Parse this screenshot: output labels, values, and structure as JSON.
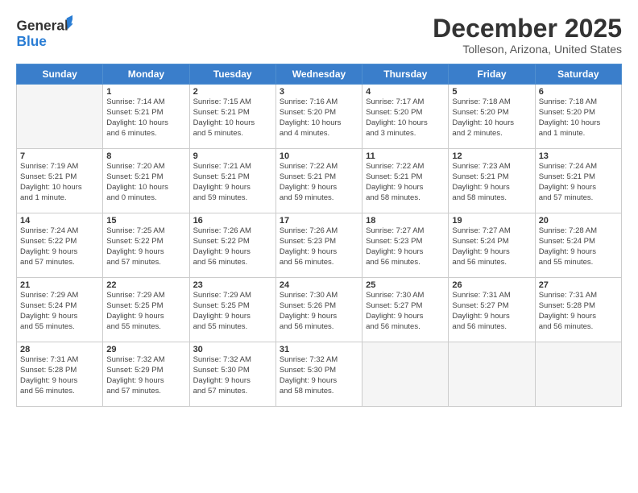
{
  "header": {
    "logo_line1": "General",
    "logo_line2": "Blue",
    "title": "December 2025",
    "subtitle": "Tolleson, Arizona, United States"
  },
  "days_of_week": [
    "Sunday",
    "Monday",
    "Tuesday",
    "Wednesday",
    "Thursday",
    "Friday",
    "Saturday"
  ],
  "weeks": [
    [
      {
        "day": "",
        "detail": ""
      },
      {
        "day": "1",
        "detail": "Sunrise: 7:14 AM\nSunset: 5:21 PM\nDaylight: 10 hours\nand 6 minutes."
      },
      {
        "day": "2",
        "detail": "Sunrise: 7:15 AM\nSunset: 5:21 PM\nDaylight: 10 hours\nand 5 minutes."
      },
      {
        "day": "3",
        "detail": "Sunrise: 7:16 AM\nSunset: 5:20 PM\nDaylight: 10 hours\nand 4 minutes."
      },
      {
        "day": "4",
        "detail": "Sunrise: 7:17 AM\nSunset: 5:20 PM\nDaylight: 10 hours\nand 3 minutes."
      },
      {
        "day": "5",
        "detail": "Sunrise: 7:18 AM\nSunset: 5:20 PM\nDaylight: 10 hours\nand 2 minutes."
      },
      {
        "day": "6",
        "detail": "Sunrise: 7:18 AM\nSunset: 5:20 PM\nDaylight: 10 hours\nand 1 minute."
      }
    ],
    [
      {
        "day": "7",
        "detail": "Sunrise: 7:19 AM\nSunset: 5:21 PM\nDaylight: 10 hours\nand 1 minute."
      },
      {
        "day": "8",
        "detail": "Sunrise: 7:20 AM\nSunset: 5:21 PM\nDaylight: 10 hours\nand 0 minutes."
      },
      {
        "day": "9",
        "detail": "Sunrise: 7:21 AM\nSunset: 5:21 PM\nDaylight: 9 hours\nand 59 minutes."
      },
      {
        "day": "10",
        "detail": "Sunrise: 7:22 AM\nSunset: 5:21 PM\nDaylight: 9 hours\nand 59 minutes."
      },
      {
        "day": "11",
        "detail": "Sunrise: 7:22 AM\nSunset: 5:21 PM\nDaylight: 9 hours\nand 58 minutes."
      },
      {
        "day": "12",
        "detail": "Sunrise: 7:23 AM\nSunset: 5:21 PM\nDaylight: 9 hours\nand 58 minutes."
      },
      {
        "day": "13",
        "detail": "Sunrise: 7:24 AM\nSunset: 5:21 PM\nDaylight: 9 hours\nand 57 minutes."
      }
    ],
    [
      {
        "day": "14",
        "detail": "Sunrise: 7:24 AM\nSunset: 5:22 PM\nDaylight: 9 hours\nand 57 minutes."
      },
      {
        "day": "15",
        "detail": "Sunrise: 7:25 AM\nSunset: 5:22 PM\nDaylight: 9 hours\nand 57 minutes."
      },
      {
        "day": "16",
        "detail": "Sunrise: 7:26 AM\nSunset: 5:22 PM\nDaylight: 9 hours\nand 56 minutes."
      },
      {
        "day": "17",
        "detail": "Sunrise: 7:26 AM\nSunset: 5:23 PM\nDaylight: 9 hours\nand 56 minutes."
      },
      {
        "day": "18",
        "detail": "Sunrise: 7:27 AM\nSunset: 5:23 PM\nDaylight: 9 hours\nand 56 minutes."
      },
      {
        "day": "19",
        "detail": "Sunrise: 7:27 AM\nSunset: 5:24 PM\nDaylight: 9 hours\nand 56 minutes."
      },
      {
        "day": "20",
        "detail": "Sunrise: 7:28 AM\nSunset: 5:24 PM\nDaylight: 9 hours\nand 55 minutes."
      }
    ],
    [
      {
        "day": "21",
        "detail": "Sunrise: 7:29 AM\nSunset: 5:24 PM\nDaylight: 9 hours\nand 55 minutes."
      },
      {
        "day": "22",
        "detail": "Sunrise: 7:29 AM\nSunset: 5:25 PM\nDaylight: 9 hours\nand 55 minutes."
      },
      {
        "day": "23",
        "detail": "Sunrise: 7:29 AM\nSunset: 5:25 PM\nDaylight: 9 hours\nand 55 minutes."
      },
      {
        "day": "24",
        "detail": "Sunrise: 7:30 AM\nSunset: 5:26 PM\nDaylight: 9 hours\nand 56 minutes."
      },
      {
        "day": "25",
        "detail": "Sunrise: 7:30 AM\nSunset: 5:27 PM\nDaylight: 9 hours\nand 56 minutes."
      },
      {
        "day": "26",
        "detail": "Sunrise: 7:31 AM\nSunset: 5:27 PM\nDaylight: 9 hours\nand 56 minutes."
      },
      {
        "day": "27",
        "detail": "Sunrise: 7:31 AM\nSunset: 5:28 PM\nDaylight: 9 hours\nand 56 minutes."
      }
    ],
    [
      {
        "day": "28",
        "detail": "Sunrise: 7:31 AM\nSunset: 5:28 PM\nDaylight: 9 hours\nand 56 minutes."
      },
      {
        "day": "29",
        "detail": "Sunrise: 7:32 AM\nSunset: 5:29 PM\nDaylight: 9 hours\nand 57 minutes."
      },
      {
        "day": "30",
        "detail": "Sunrise: 7:32 AM\nSunset: 5:30 PM\nDaylight: 9 hours\nand 57 minutes."
      },
      {
        "day": "31",
        "detail": "Sunrise: 7:32 AM\nSunset: 5:30 PM\nDaylight: 9 hours\nand 58 minutes."
      },
      {
        "day": "",
        "detail": ""
      },
      {
        "day": "",
        "detail": ""
      },
      {
        "day": "",
        "detail": ""
      }
    ]
  ]
}
